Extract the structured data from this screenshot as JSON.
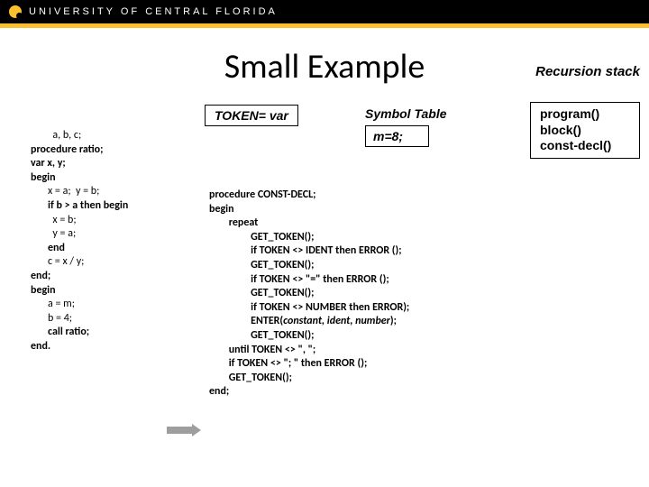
{
  "header": {
    "university": "UNIVERSITY OF CENTRAL FLORIDA"
  },
  "title": "Small Example",
  "recursion_label": "Recursion stack",
  "token_box": "TOKEN= var",
  "symbol_table_label": "Symbol Table",
  "symbol_table_box": "m=8;",
  "stack": {
    "line1": "program()",
    "line2": "block()",
    "line3": "const-decl()"
  },
  "code_left": {
    "l1": "         a, b, c;",
    "l2": "procedure ratio;",
    "l3": "var x, y;",
    "l4": "begin",
    "l5": "       x = a;  y = b;",
    "l6": "       if b > a then begin",
    "l7": "         x = b;",
    "l8": "         y = a;",
    "l9": "       end",
    "l10": "       c = x / y;",
    "l11": "end;",
    "l12": "begin",
    "l13": "       a = m;",
    "l14": "       b = 4;",
    "l15": "       call ratio;",
    "l16": "end."
  },
  "code_right": {
    "l1": "procedure CONST-DECL;",
    "l2": "begin",
    "l3": "        repeat",
    "l4": "                 GET_TOKEN();",
    "l5": "                 if TOKEN <> IDENT then ERROR ();",
    "l6": "                 GET_TOKEN();",
    "l7": "                 if TOKEN <> \"=\" then ERROR ();",
    "l8": "                 GET_TOKEN();",
    "l9": "                 if TOKEN <> NUMBER then ERROR);",
    "l10a": "                 ENTER(",
    "l10b": "constant, ident, number",
    "l10c": ");",
    "l11": "                 GET_TOKEN();",
    "l12": "        until TOKEN <> \", \";",
    "l13": "        if TOKEN <> \"; \" then ERROR ();",
    "l14": "        GET_TOKEN();",
    "l15": "end;"
  }
}
